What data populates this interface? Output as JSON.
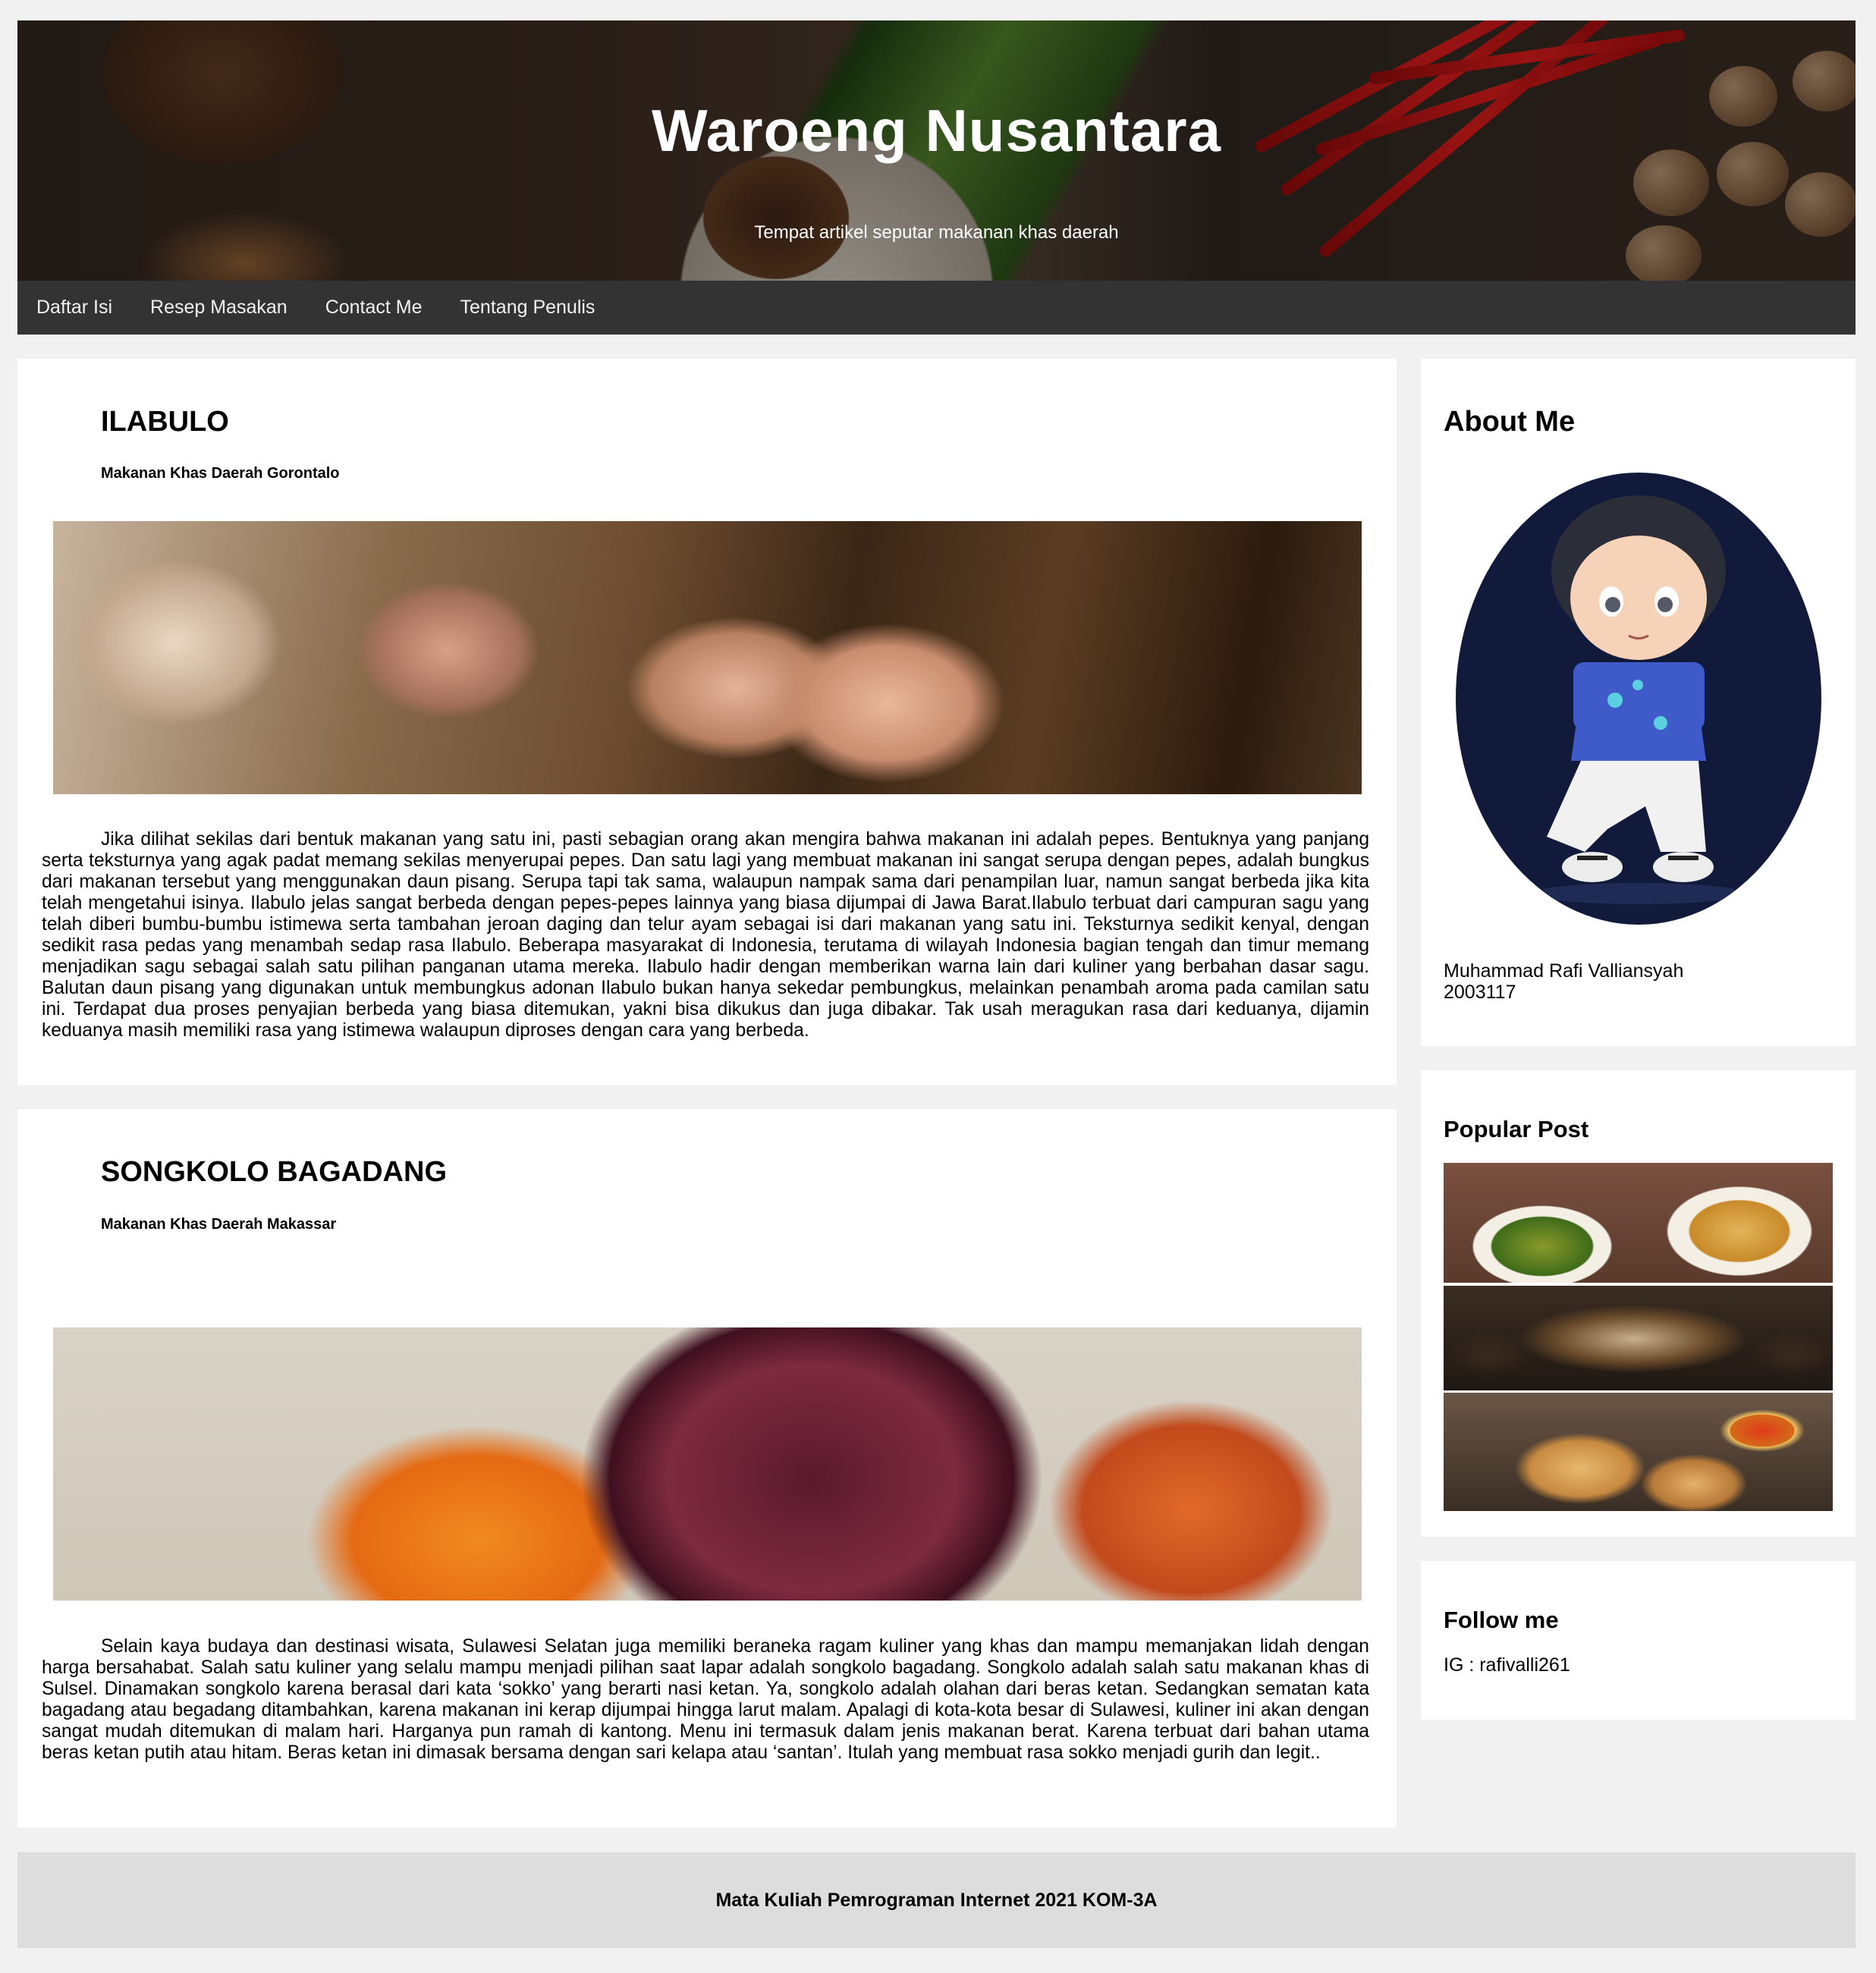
{
  "header": {
    "title": "Waroeng Nusantara",
    "subtitle": "Tempat artikel seputar makanan khas daerah"
  },
  "nav": {
    "items": [
      "Daftar Isi",
      "Resep Masakan",
      "Contact Me",
      "Tentang Penulis"
    ]
  },
  "posts": [
    {
      "title": "ILABULO",
      "subtitle": "Makanan Khas Daerah Gorontalo",
      "image": "ilabulo-photo",
      "body": "Jika dilihat sekilas dari bentuk makanan yang satu ini, pasti sebagian orang akan mengira bahwa makanan ini adalah pepes. Bentuknya yang panjang serta teksturnya yang agak padat memang sekilas menyerupai pepes. Dan satu lagi yang membuat makanan ini sangat serupa dengan pepes, adalah bungkus dari makanan tersebut yang menggunakan daun pisang. Serupa tapi tak sama, walaupun nampak sama dari penampilan luar, namun sangat berbeda jika kita telah mengetahui isinya. Ilabulo jelas sangat berbeda dengan pepes-pepes lainnya yang biasa dijumpai di Jawa Barat.Ilabulo terbuat dari campuran sagu yang telah diberi bumbu-bumbu istimewa serta tambahan jeroan daging dan telur ayam sebagai isi dari makanan yang satu ini. Teksturnya sedikit kenyal, dengan sedikit rasa pedas yang menambah sedap rasa Ilabulo. Beberapa masyarakat di Indonesia, terutama di wilayah Indonesia bagian tengah dan timur memang menjadikan sagu sebagai salah satu pilihan panganan utama mereka. Ilabulo hadir dengan memberikan warna lain dari kuliner yang berbahan dasar sagu. Balutan daun pisang yang digunakan untuk membungkus adonan Ilabulo bukan hanya sekedar pembungkus, melainkan penambah aroma pada camilan satu ini. Terdapat dua proses penyajian berbeda yang biasa ditemukan, yakni bisa dikukus dan juga dibakar. Tak usah meragukan rasa dari keduanya, dijamin keduanya masih memiliki rasa yang istimewa walaupun diproses dengan cara yang berbeda."
    },
    {
      "title": "SONGKOLO BAGADANG",
      "subtitle": "Makanan Khas Daerah Makassar",
      "image": "songkolo-photo",
      "body": "Selain kaya budaya dan destinasi wisata, Sulawesi Selatan juga memiliki beraneka ragam kuliner yang khas dan mampu memanjakan lidah dengan harga bersahabat. Salah satu kuliner yang selalu mampu menjadi pilihan saat lapar adalah songkolo bagadang. Songkolo adalah salah satu makanan khas di Sulsel. Dinamakan songkolo karena berasal dari kata ‘sokko’ yang berarti nasi ketan. Ya, songkolo adalah olahan dari beras ketan. Sedangkan sematan kata bagadang atau begadang ditambahkan, karena makanan ini kerap dijumpai hingga larut malam. Apalagi di kota-kota besar di Sulawesi, kuliner ini akan dengan sangat mudah ditemukan di malam hari. Harganya pun ramah di kantong. Menu ini termasuk dalam jenis makanan berat. Karena terbuat dari bahan utama beras ketan putih atau hitam. Beras ketan ini dimasak bersama dengan sari kelapa atau ‘santan’. Itulah yang membuat rasa sokko menjadi gurih dan legit.."
    }
  ],
  "sidebar": {
    "about": {
      "heading": "About Me",
      "name": "Muhammad Rafi Valliansyah",
      "id": "2003117"
    },
    "popular": {
      "heading": "Popular Post"
    },
    "follow": {
      "heading": "Follow me",
      "handle": "IG : rafivalli261"
    }
  },
  "footer": {
    "text": "Mata Kuliah Pemrograman Internet 2021 KOM-3A"
  }
}
